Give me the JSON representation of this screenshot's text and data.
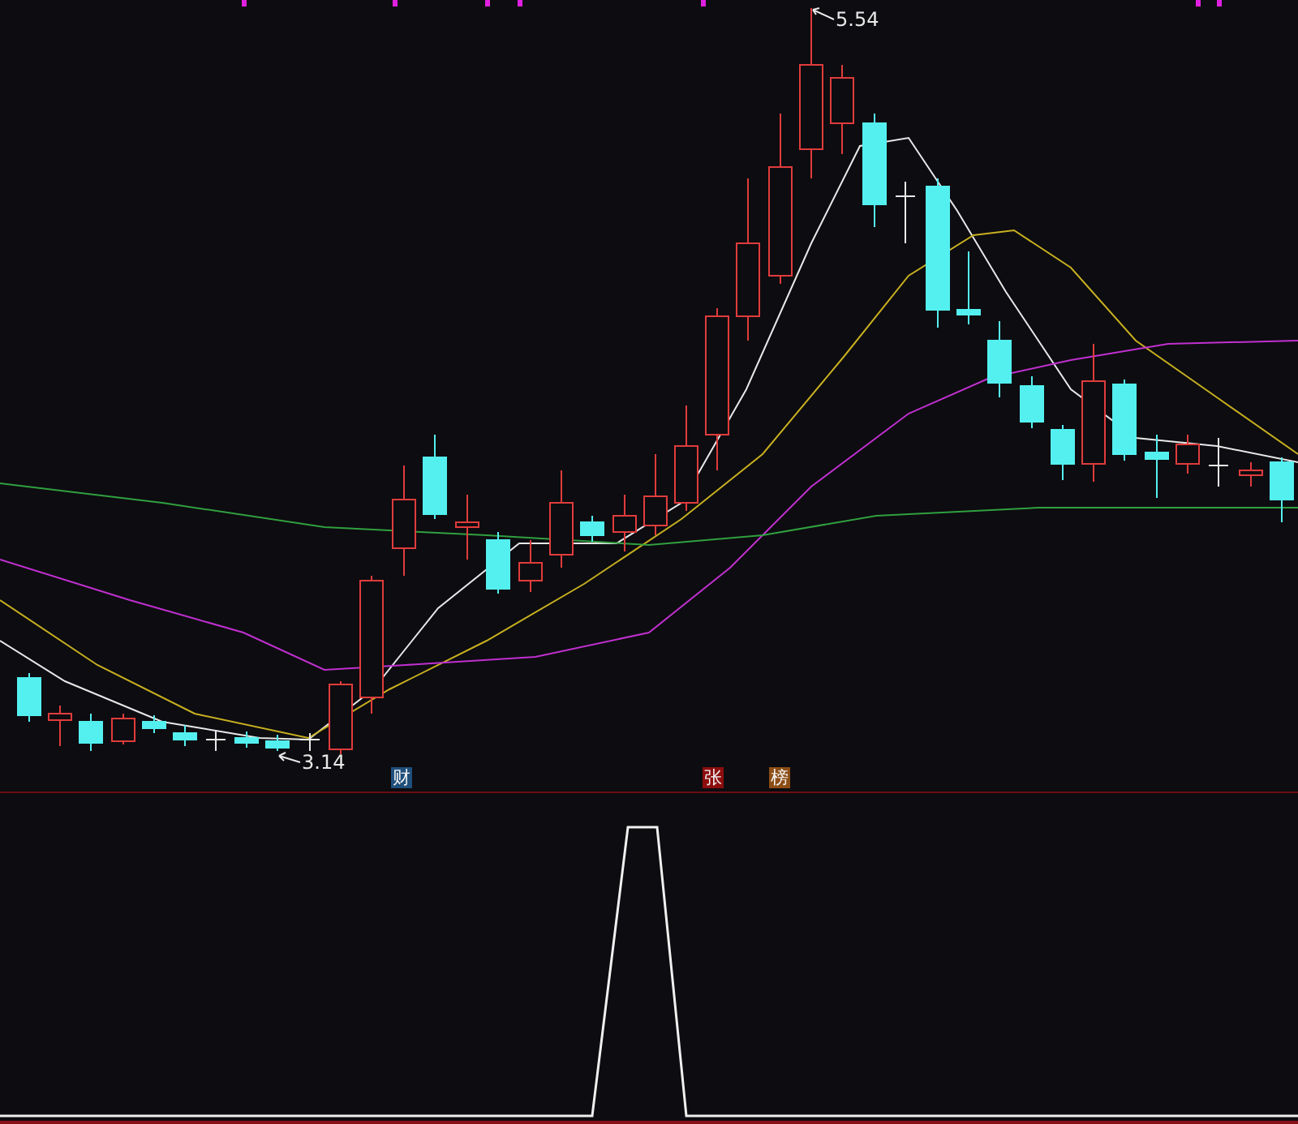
{
  "price_chart": {
    "high_label": "5.54",
    "low_label": "3.14",
    "markers": [
      {
        "text": "财",
        "color": "#1f4f7a"
      },
      {
        "text": "张",
        "color": "#8c0d0d"
      },
      {
        "text": "榜",
        "color": "#8c4d14"
      }
    ]
  }
}
